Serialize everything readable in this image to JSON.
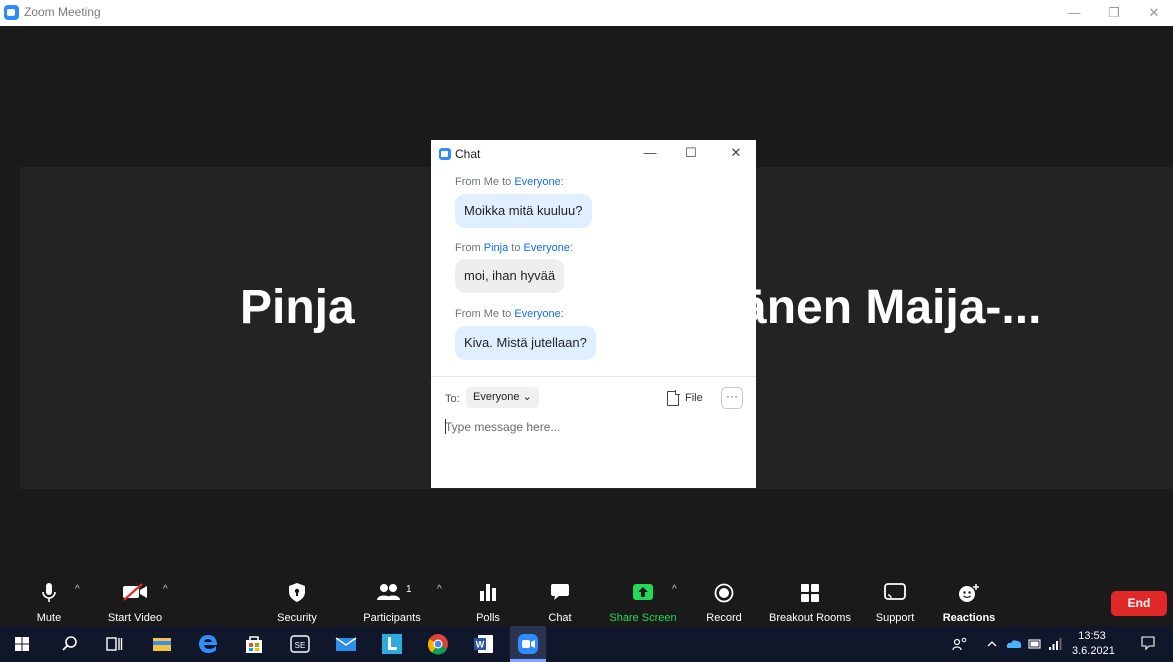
{
  "window": {
    "title": "Zoom Meeting",
    "minimize_glyph": "—",
    "restore_glyph": "❐",
    "close_glyph": "✕"
  },
  "participants": {
    "left_name": "Pinja",
    "right_name": "änen  Maija-..."
  },
  "chat": {
    "title": "Chat",
    "minimize_glyph": "—",
    "maximize_glyph": "☐",
    "close_glyph": "✕",
    "messages": [
      {
        "from_prefix": "From ",
        "sender": "Me",
        "to_word": " to ",
        "recipient": "Everyone",
        "suffix": ":",
        "text": "Moikka mitä kuuluu?"
      },
      {
        "from_prefix": "From ",
        "sender": "Pinja",
        "to_word": " to ",
        "recipient": "Everyone",
        "suffix": ":",
        "text": "moi, ihan hyvää"
      },
      {
        "from_prefix": "From ",
        "sender": "Me",
        "to_word": " to ",
        "recipient": "Everyone",
        "suffix": ":",
        "text": "Kiva. Mistä jutellaan?"
      }
    ],
    "to_label": "To:",
    "to_value": "Everyone",
    "to_chevron": "⌄",
    "file_label": "File",
    "more_label": "···",
    "input_placeholder": "Type message here...",
    "input_value": ""
  },
  "toolbar": {
    "mute": "Mute",
    "start_video": "Start Video",
    "security": "Security",
    "participants": "Participants",
    "participants_count": "1",
    "polls": "Polls",
    "chat": "Chat",
    "share_screen": "Share Screen",
    "record": "Record",
    "breakout_rooms": "Breakout Rooms",
    "support": "Support",
    "reactions": "Reactions",
    "end": "End",
    "caret": "^"
  },
  "taskbar": {
    "time": "13:53",
    "date": "3.6.2021"
  },
  "colors": {
    "accent": "#2d8cff",
    "share_green": "#23d959",
    "end_red": "#e02828",
    "link_blue": "#0e72ed"
  },
  "icons": [
    "windows-logo-icon",
    "search-icon",
    "task-view-icon",
    "file-explorer-icon",
    "edge-icon",
    "store-icon",
    "se-app-icon",
    "mail-icon",
    "l-app-icon",
    "chrome-icon",
    "word-icon",
    "zoom-icon"
  ]
}
